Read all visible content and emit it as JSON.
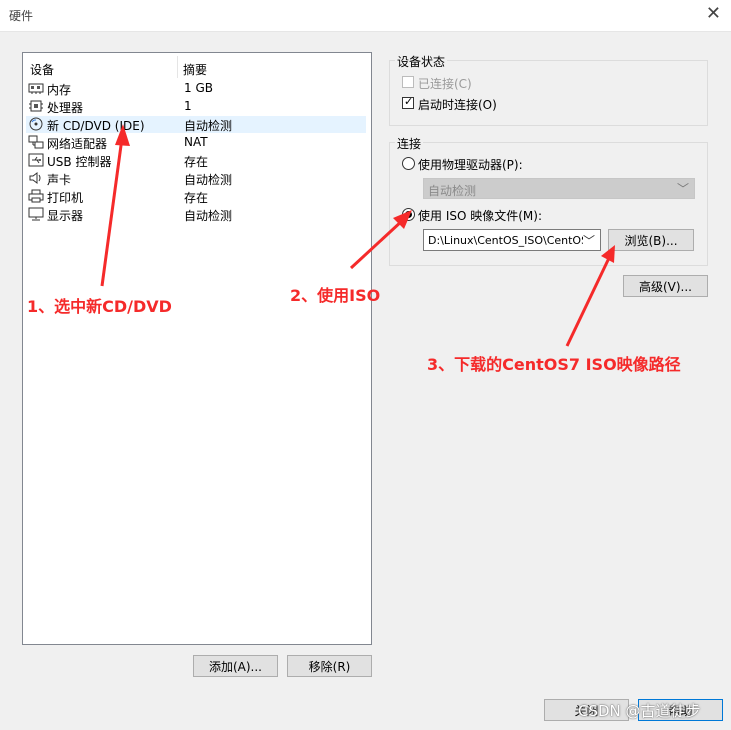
{
  "window": {
    "title": "硬件"
  },
  "devices": {
    "header_device": "设备",
    "header_summary": "摘要",
    "rows": [
      {
        "name": "内存",
        "summary": "1 GB",
        "icon": "memory-icon"
      },
      {
        "name": "处理器",
        "summary": "1",
        "icon": "processor-icon"
      },
      {
        "name": "新 CD/DVD (IDE)",
        "summary": "自动检测",
        "icon": "cd-dvd-icon"
      },
      {
        "name": "网络适配器",
        "summary": "NAT",
        "icon": "network-adapter-icon"
      },
      {
        "name": "USB 控制器",
        "summary": "存在",
        "icon": "usb-icon"
      },
      {
        "name": "声卡",
        "summary": "自动检测",
        "icon": "sound-card-icon"
      },
      {
        "name": "打印机",
        "summary": "存在",
        "icon": "printer-icon"
      },
      {
        "name": "显示器",
        "summary": "自动检测",
        "icon": "display-icon"
      }
    ],
    "add_label": "添加(A)...",
    "remove_label": "移除(R)"
  },
  "device_status": {
    "title": "设备状态",
    "connected_label": "已连接(C)",
    "connect_at_power_on_label": "启动时连接(O)"
  },
  "connection": {
    "title": "连接",
    "physical_drive_label": "使用物理驱动器(P):",
    "physical_drive_value": "自动检测",
    "iso_label": "使用 ISO 映像文件(M):",
    "iso_path": "D:\\Linux\\CentOS_ISO\\CentOS",
    "browse_label": "浏览(B)..."
  },
  "advanced_label": "高级(V)...",
  "footer": {
    "close_label": "关闭",
    "help_label": "帮助"
  },
  "annotations": {
    "step1": "1、选中新CD/DVD",
    "step2": "2、使用ISO",
    "step3": "3、下载的CentOS7 ISO映像路径"
  },
  "watermark": "CSDN @古道徒步",
  "colors": {
    "annotation": "#f52a2a",
    "selection": "#e5f3ff",
    "focus_border": "#0078d7"
  }
}
